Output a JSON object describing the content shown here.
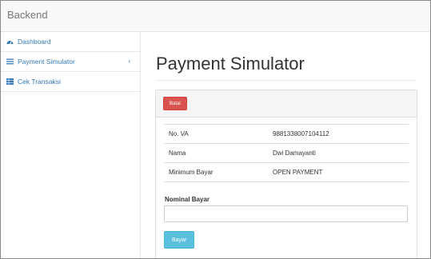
{
  "app": {
    "brand": "Backend"
  },
  "sidebar": {
    "items": [
      {
        "label": "Dashboard",
        "icon": "dashboard-icon"
      },
      {
        "label": "Payment Simulator",
        "icon": "list-icon",
        "caret": "‹"
      },
      {
        "label": "Cek Transaksi",
        "icon": "table-icon"
      }
    ]
  },
  "main": {
    "title": "Payment Simulator",
    "panel": {
      "cancel_label": "Batal",
      "rows": [
        {
          "label": "No. VA",
          "value": "9881338007104112"
        },
        {
          "label": "Nama",
          "value": "Dwi Damayanti"
        },
        {
          "label": "Minimum Bayar",
          "value": "OPEN PAYMENT"
        }
      ],
      "amount_label": "Nominal Bayar",
      "amount_value": "",
      "pay_label": "Bayar"
    }
  },
  "colors": {
    "danger": "#d9534f",
    "info": "#5bc0de",
    "link": "#337ab7",
    "navbar_bg": "#f8f8f8"
  }
}
